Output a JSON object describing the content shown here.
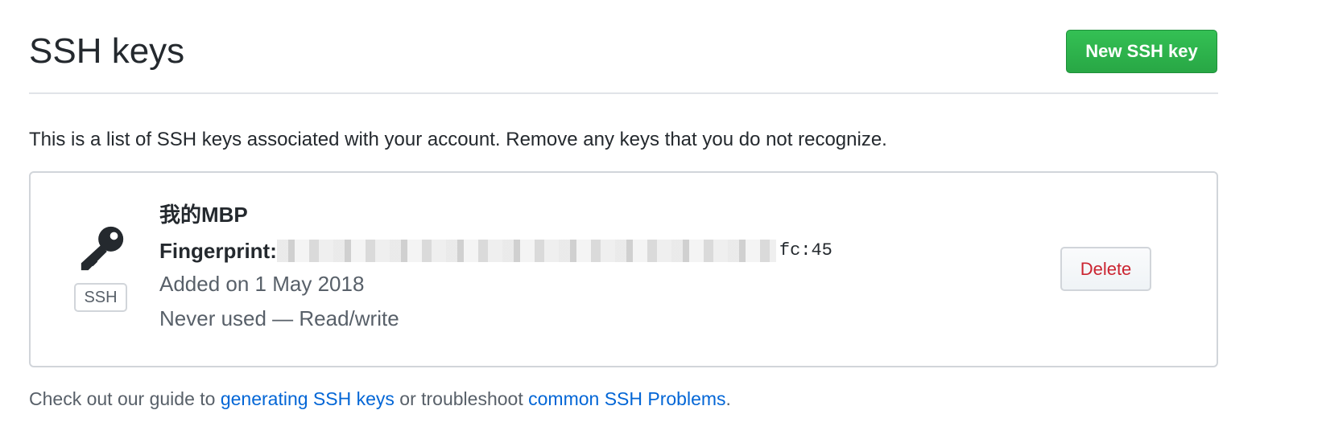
{
  "header": {
    "title": "SSH keys",
    "new_key_button": "New SSH key"
  },
  "intro": {
    "text": "This is a list of SSH keys associated with your account. Remove any keys that you do not recognize."
  },
  "ssh_keys": [
    {
      "icon": "key-icon",
      "type_badge": "SSH",
      "title": "我的MBP",
      "fingerprint_label": "Fingerprint:",
      "fingerprint_visible_suffix": "fc:45",
      "added": "Added on 1 May 2018",
      "usage": "Never used — Read/write",
      "delete_label": "Delete"
    }
  ],
  "footer": {
    "prefix": "Check out our guide to ",
    "link1": "generating SSH keys",
    "middle": " or troubleshoot ",
    "link2": "common SSH Problems",
    "suffix": "."
  },
  "colors": {
    "primary_button": "#28a745",
    "danger_text": "#cb2431",
    "link": "#0366d6",
    "muted_text": "#586069",
    "border": "#d1d5da"
  }
}
